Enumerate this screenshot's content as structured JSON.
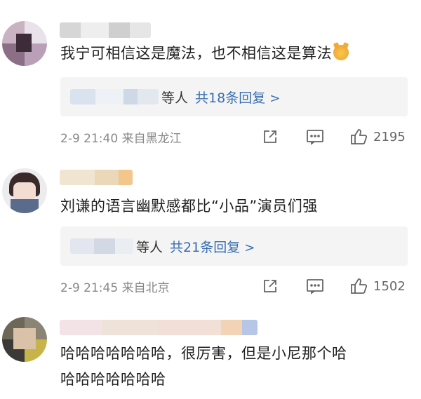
{
  "comments": [
    {
      "text": "我宁可相信这是魔法，也不相信这是算法",
      "emoji": "doge-emoji",
      "reply_suffix": "等人",
      "reply_count": "共18条回复",
      "chevron": ">",
      "timestamp": "2-9 21:40",
      "location": "来自黑龙江",
      "likes": "2195"
    },
    {
      "text": "刘谦的语言幽默感都比“小品”演员们强",
      "reply_suffix": "等人",
      "reply_count": "共21条回复",
      "chevron": ">",
      "timestamp": "2-9 21:45",
      "location": "来自北京",
      "likes": "1502"
    },
    {
      "text_line1": "哈哈哈哈哈哈哈，很厉害，但是小尼那个哈",
      "text_line2": "哈哈哈哈哈哈哈"
    }
  ],
  "colors": {
    "link": "#3a6fb0",
    "meta_text": "#888888",
    "reply_bg": "#f4f4f4"
  }
}
